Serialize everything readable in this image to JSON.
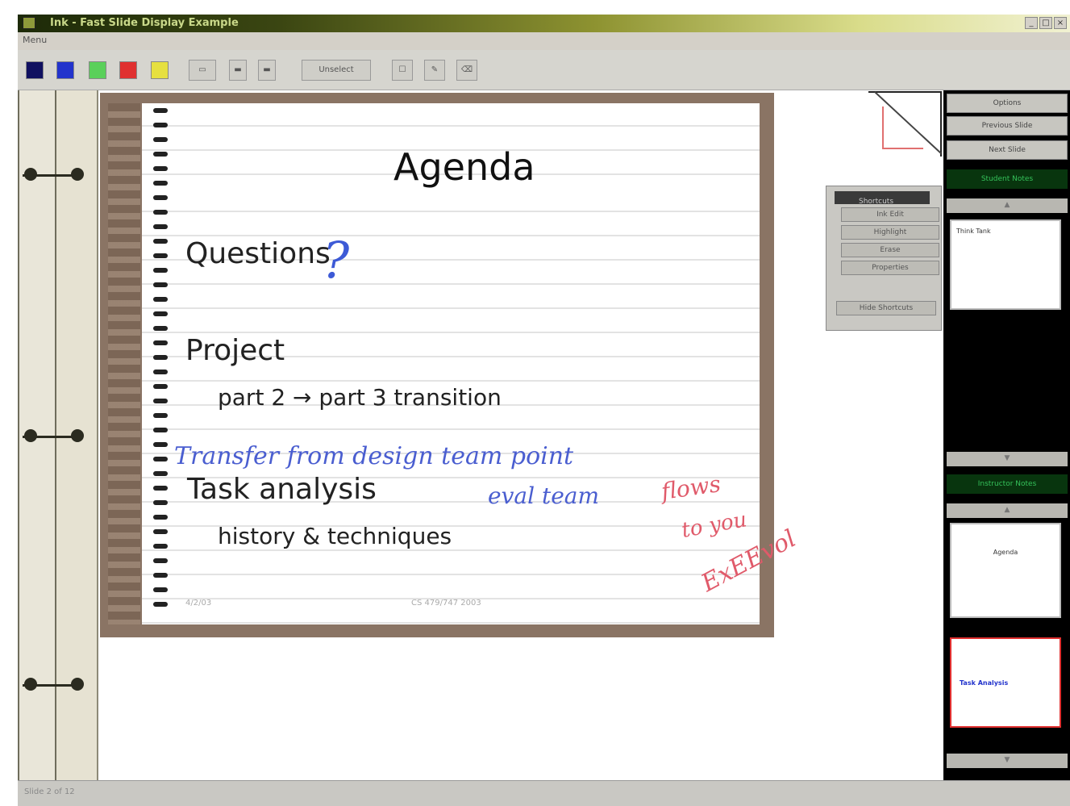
{
  "window": {
    "title": "Ink - Fast Slide Display Example",
    "menu": "Menu",
    "buttons": [
      "_",
      "□",
      "×"
    ]
  },
  "toolbar": {
    "swatches": [
      {
        "name": "color-navy",
        "color": "#101060"
      },
      {
        "name": "color-blue",
        "color": "#2233cc"
      },
      {
        "name": "color-green",
        "color": "#5ad05a"
      },
      {
        "name": "color-red",
        "color": "#e03030"
      },
      {
        "name": "color-yellow",
        "color": "#e6e040"
      }
    ],
    "clear_label": "Unselect"
  },
  "slide": {
    "title": "Agenda",
    "lines": [
      {
        "text": "Questions",
        "indent": 0
      },
      {
        "text": "Project",
        "indent": 0
      },
      {
        "text": "part 2 → part 3 transition",
        "indent": 1
      },
      {
        "text": "Task analysis",
        "indent": 0
      },
      {
        "text": "history & techniques",
        "indent": 1
      }
    ],
    "footer_left": "4/2/03",
    "footer_center": "CS 479/747 2003"
  },
  "ink_annotations": [
    {
      "text": "?",
      "color": "#3d5ad6"
    },
    {
      "text": "Transfer from design team point",
      "color": "#4a5ed0"
    },
    {
      "text": "eval team",
      "color": "#4a5ed0"
    },
    {
      "text": "flows",
      "color": "#e05a6a"
    },
    {
      "text": "to you",
      "color": "#e05a6a"
    },
    {
      "text": "ExEEvol",
      "color": "#e05a6a"
    }
  ],
  "palette": {
    "title": "Shortcuts",
    "buttons": [
      "Ink Edit",
      "Highlight",
      "Erase",
      "Properties",
      "Hide Shortcuts"
    ]
  },
  "right_panel": {
    "top_buttons": [
      "Options",
      "Previous Slide",
      "Next Slide"
    ],
    "student_label": "Student Notes",
    "instructor_label": "Instructor Notes",
    "thumb_label_1": "Think Tank",
    "thumb_label_2": "Agenda",
    "thumb_label_3": "Task Analysis"
  },
  "status": {
    "text": "Slide 2 of 12"
  }
}
